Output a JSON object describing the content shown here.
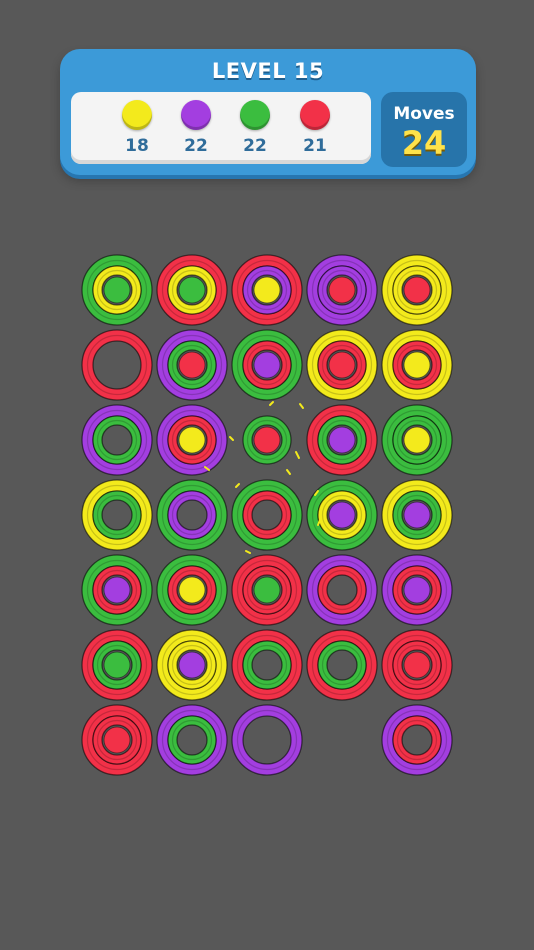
{
  "colors": {
    "yellow": "#f3ea1c",
    "purple": "#a33ee0",
    "green": "#3bbd3f",
    "red": "#f23148",
    "hud_blue": "#3c9ad8",
    "moves_yellow": "#ffe24a"
  },
  "header": {
    "level_title": "LEVEL 15",
    "moves_label": "Moves",
    "moves_value": "24"
  },
  "goals": [
    {
      "color": "yellow",
      "count": "18"
    },
    {
      "color": "purple",
      "count": "22"
    },
    {
      "color": "green",
      "count": "22"
    },
    {
      "color": "red",
      "count": "21"
    }
  ],
  "board": {
    "rows": 7,
    "cols": 5,
    "cells": [
      [
        {
          "large": "green",
          "medium": "yellow",
          "small": "green"
        },
        {
          "large": "red",
          "medium": "yellow",
          "small": "green"
        },
        {
          "large": "red",
          "medium": "purple",
          "small": "yellow"
        },
        {
          "large": "purple",
          "medium": "purple",
          "small": "red"
        },
        {
          "large": "yellow",
          "medium": "yellow",
          "small": "red"
        }
      ],
      [
        {
          "large": "red",
          "medium": null,
          "small": null
        },
        {
          "large": "purple",
          "medium": "green",
          "small": "red"
        },
        {
          "large": "green",
          "medium": "red",
          "small": "purple"
        },
        {
          "large": "yellow",
          "medium": "red",
          "small": "red"
        },
        {
          "large": "yellow",
          "medium": "red",
          "small": "yellow"
        }
      ],
      [
        {
          "large": "purple",
          "medium": "green",
          "small": null
        },
        {
          "large": "purple",
          "medium": "red",
          "small": "yellow"
        },
        {
          "large": null,
          "medium": "green",
          "small": "red"
        },
        {
          "large": "red",
          "medium": "green",
          "small": "purple"
        },
        {
          "large": "green",
          "medium": "green",
          "small": "yellow"
        }
      ],
      [
        {
          "large": "yellow",
          "medium": "green",
          "small": null
        },
        {
          "large": "green",
          "medium": "purple",
          "small": null
        },
        {
          "large": "green",
          "medium": "red",
          "small": null
        },
        {
          "large": "green",
          "medium": "yellow",
          "small": "purple"
        },
        {
          "large": "yellow",
          "medium": "green",
          "small": "purple"
        }
      ],
      [
        {
          "large": "green",
          "medium": "red",
          "small": "purple"
        },
        {
          "large": "green",
          "medium": "red",
          "small": "yellow"
        },
        {
          "large": "red",
          "medium": "red",
          "small": "green"
        },
        {
          "large": "purple",
          "medium": "red",
          "small": null
        },
        {
          "large": "purple",
          "medium": "red",
          "small": "purple"
        }
      ],
      [
        {
          "large": "red",
          "medium": "green",
          "small": "green"
        },
        {
          "large": "yellow",
          "medium": "yellow",
          "small": "purple"
        },
        {
          "large": "red",
          "medium": "green",
          "small": null
        },
        {
          "large": "red",
          "medium": "green",
          "small": null
        },
        {
          "large": "red",
          "medium": "red",
          "small": "red"
        }
      ],
      [
        {
          "large": "red",
          "medium": "red",
          "small": "red"
        },
        {
          "large": "purple",
          "medium": "green",
          "small": null
        },
        {
          "large": "purple",
          "medium": null,
          "small": null
        },
        null,
        {
          "large": "purple",
          "medium": "red",
          "small": null
        }
      ]
    ]
  }
}
